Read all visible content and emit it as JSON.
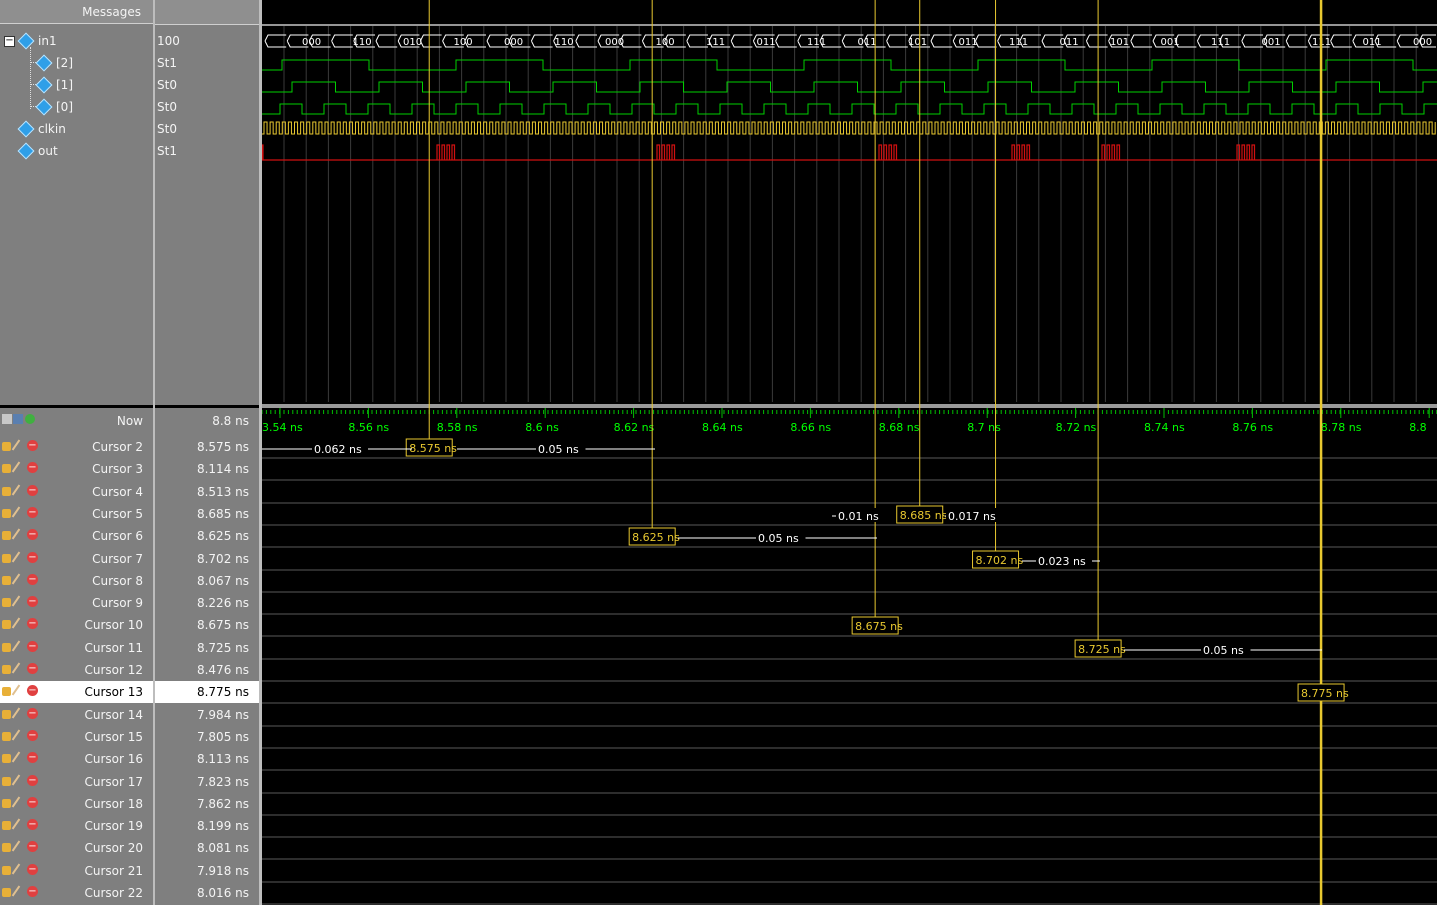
{
  "header": {
    "messages_label": "Messages"
  },
  "signals": [
    {
      "name": "in1",
      "value": "100"
    },
    {
      "name": "[2]",
      "value": "St1"
    },
    {
      "name": "[1]",
      "value": "St0"
    },
    {
      "name": "[0]",
      "value": "St0"
    },
    {
      "name": "clkin",
      "value": "St0"
    },
    {
      "name": "out",
      "value": "St1"
    }
  ],
  "bus_labels": [
    "000",
    "110",
    "010",
    "100",
    "000",
    "110",
    "000",
    "100",
    "111",
    "011",
    "111",
    "011",
    "101",
    "011",
    "111",
    "011",
    "101",
    "001",
    "111",
    "001",
    "111",
    "011",
    "000"
  ],
  "now": {
    "label": "Now",
    "value": "8.8 ns"
  },
  "cursors": [
    {
      "name": "Cursor 2",
      "value": "8.575 ns"
    },
    {
      "name": "Cursor 3",
      "value": "8.114 ns"
    },
    {
      "name": "Cursor 4",
      "value": "8.513 ns"
    },
    {
      "name": "Cursor 5",
      "value": "8.685 ns"
    },
    {
      "name": "Cursor 6",
      "value": "8.625 ns"
    },
    {
      "name": "Cursor 7",
      "value": "8.702 ns"
    },
    {
      "name": "Cursor 8",
      "value": "8.067 ns"
    },
    {
      "name": "Cursor 9",
      "value": "8.226 ns"
    },
    {
      "name": "Cursor 10",
      "value": "8.675 ns"
    },
    {
      "name": "Cursor 11",
      "value": "8.725 ns"
    },
    {
      "name": "Cursor 12",
      "value": "8.476 ns"
    },
    {
      "name": "Cursor 13",
      "value": "8.775 ns",
      "selected": true
    },
    {
      "name": "Cursor 14",
      "value": "7.984 ns"
    },
    {
      "name": "Cursor 15",
      "value": "7.805 ns"
    },
    {
      "name": "Cursor 16",
      "value": "8.113 ns"
    },
    {
      "name": "Cursor 17",
      "value": "7.823 ns"
    },
    {
      "name": "Cursor 18",
      "value": "7.862 ns"
    },
    {
      "name": "Cursor 19",
      "value": "8.199 ns"
    },
    {
      "name": "Cursor 20",
      "value": "8.081 ns"
    },
    {
      "name": "Cursor 21",
      "value": "7.918 ns"
    },
    {
      "name": "Cursor 22",
      "value": "8.016 ns"
    }
  ],
  "timeline": {
    "ticks": [
      "3.54 ns",
      "8.56 ns",
      "8.58 ns",
      "8.6 ns",
      "8.62 ns",
      "8.64 ns",
      "8.66 ns",
      "8.68 ns",
      "8.7 ns",
      "8.72 ns",
      "8.74 ns",
      "8.76 ns",
      "8.78 ns",
      "8.8"
    ]
  },
  "cursor_tags": [
    {
      "text": "8.575 ns",
      "time": 8.575,
      "row": 0
    },
    {
      "text": "8.685 ns",
      "time": 8.685,
      "row": 3
    },
    {
      "text": "8.625 ns",
      "time": 8.625,
      "row": 4
    },
    {
      "text": "8.702 ns",
      "time": 8.702,
      "row": 5
    },
    {
      "text": "8.675 ns",
      "time": 8.675,
      "row": 8
    },
    {
      "text": "8.725 ns",
      "time": 8.725,
      "row": 9
    },
    {
      "text": "8.775 ns",
      "time": 8.775,
      "row": 11
    }
  ],
  "deltas": [
    {
      "text": "0.062 ns",
      "row": 0
    },
    {
      "text": "0.05 ns",
      "row": 0
    },
    {
      "text": "0.01 ns",
      "row": 3
    },
    {
      "text": "0.017 ns",
      "row": 3
    },
    {
      "text": "0.05 ns",
      "row": 4
    },
    {
      "text": "0.023 ns",
      "row": 5
    },
    {
      "text": "0.05 ns",
      "row": 9
    }
  ],
  "colors": {
    "bus": "#ffffff",
    "green": "#00d000",
    "clk": "#e8c830",
    "out": "#d01010",
    "cursor": "#e8c830",
    "tick_text": "#00ff00"
  }
}
